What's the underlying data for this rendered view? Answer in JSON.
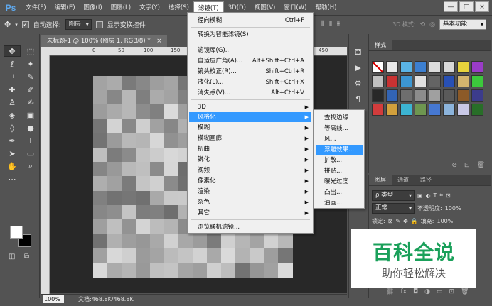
{
  "menubar": {
    "logo": "Ps",
    "items": [
      "文件(F)",
      "编辑(E)",
      "图像(I)",
      "图层(L)",
      "文字(Y)",
      "选择(S)",
      "滤镜(T)",
      "3D(D)",
      "视图(V)",
      "窗口(W)",
      "帮助(H)"
    ],
    "active_index": 6,
    "window_controls": [
      "—",
      "□",
      "×"
    ]
  },
  "options": {
    "auto_select_label": "自动选择:",
    "auto_select_value": "图层",
    "show_transform_label": "显示变换控件",
    "mode_3d_label": "3D 模式:",
    "workspace": "基本功能"
  },
  "document": {
    "tab_title": "未标题-1 @ 100% (图层 1, RGB/8) *",
    "tab_close": "×",
    "ruler_ticks": [
      "0",
      "50",
      "100",
      "150",
      "450"
    ],
    "zoom": "100%",
    "doc_info": "文档:468.8K/468.8K"
  },
  "filter_menu": {
    "items": [
      {
        "label": "径向模糊",
        "shortcut": "Ctrl+F"
      },
      {
        "label": "转换为智能滤镜(S)"
      },
      {
        "label": "滤镜库(G)..."
      },
      {
        "label": "自适应广角(A)...",
        "shortcut": "Alt+Shift+Ctrl+A"
      },
      {
        "label": "镜头校正(R)...",
        "shortcut": "Shift+Ctrl+R"
      },
      {
        "label": "液化(L)...",
        "shortcut": "Shift+Ctrl+X"
      },
      {
        "label": "消失点(V)...",
        "shortcut": "Alt+Ctrl+V"
      },
      {
        "label": "3D",
        "submenu": true
      },
      {
        "label": "风格化",
        "submenu": true,
        "highlighted": true
      },
      {
        "label": "模糊",
        "submenu": true
      },
      {
        "label": "模糊画廊",
        "submenu": true
      },
      {
        "label": "扭曲",
        "submenu": true
      },
      {
        "label": "锐化",
        "submenu": true
      },
      {
        "label": "视频",
        "submenu": true
      },
      {
        "label": "像素化",
        "submenu": true
      },
      {
        "label": "渲染",
        "submenu": true
      },
      {
        "label": "杂色",
        "submenu": true
      },
      {
        "label": "其它",
        "submenu": true
      },
      {
        "label": "浏览联机滤镜..."
      }
    ]
  },
  "stylize_submenu": {
    "items": [
      "查找边缘",
      "等高线...",
      "风...",
      "浮雕效果...",
      "扩散...",
      "拼贴...",
      "曝光过度",
      "凸出...",
      "油画..."
    ],
    "highlighted_index": 3
  },
  "styles_panel": {
    "tab": "样式",
    "swatch_colors": [
      "#ffffff",
      "#e8e8e8",
      "#5ab4e6",
      "#3c7fd0",
      "#dcdcdc",
      "#d8d8d8",
      "#e6d23c",
      "#9a3cc8",
      "#c0c0c0",
      "#c83232",
      "#3c96d2",
      "#e0e0e0",
      "#646464",
      "#2850b4",
      "#d2b46e",
      "#3cc83c",
      "#282828",
      "#3264b4",
      "#6e6e6e",
      "#8c8c8c",
      "#a0a0a0",
      "#5a5a5a",
      "#8c5a28",
      "#3c3c8c",
      "#d23c3c",
      "#d2a03c",
      "#3cb4d2",
      "#6e9650",
      "#4678d2",
      "#8cb4dc",
      "#c8c8e6",
      "#286e28"
    ]
  },
  "layers_panel": {
    "tabs": [
      "图层",
      "通道",
      "路径"
    ],
    "filter_kind": "ρ 类型",
    "blend_mode": "正常",
    "opacity_label": "不透明度:",
    "opacity_value": "100%",
    "lock_label": "锁定:",
    "fill_label": "填充:",
    "fill_value": "100%"
  },
  "watermark": {
    "line1": "百科全说",
    "line2": "助你轻松解决"
  }
}
